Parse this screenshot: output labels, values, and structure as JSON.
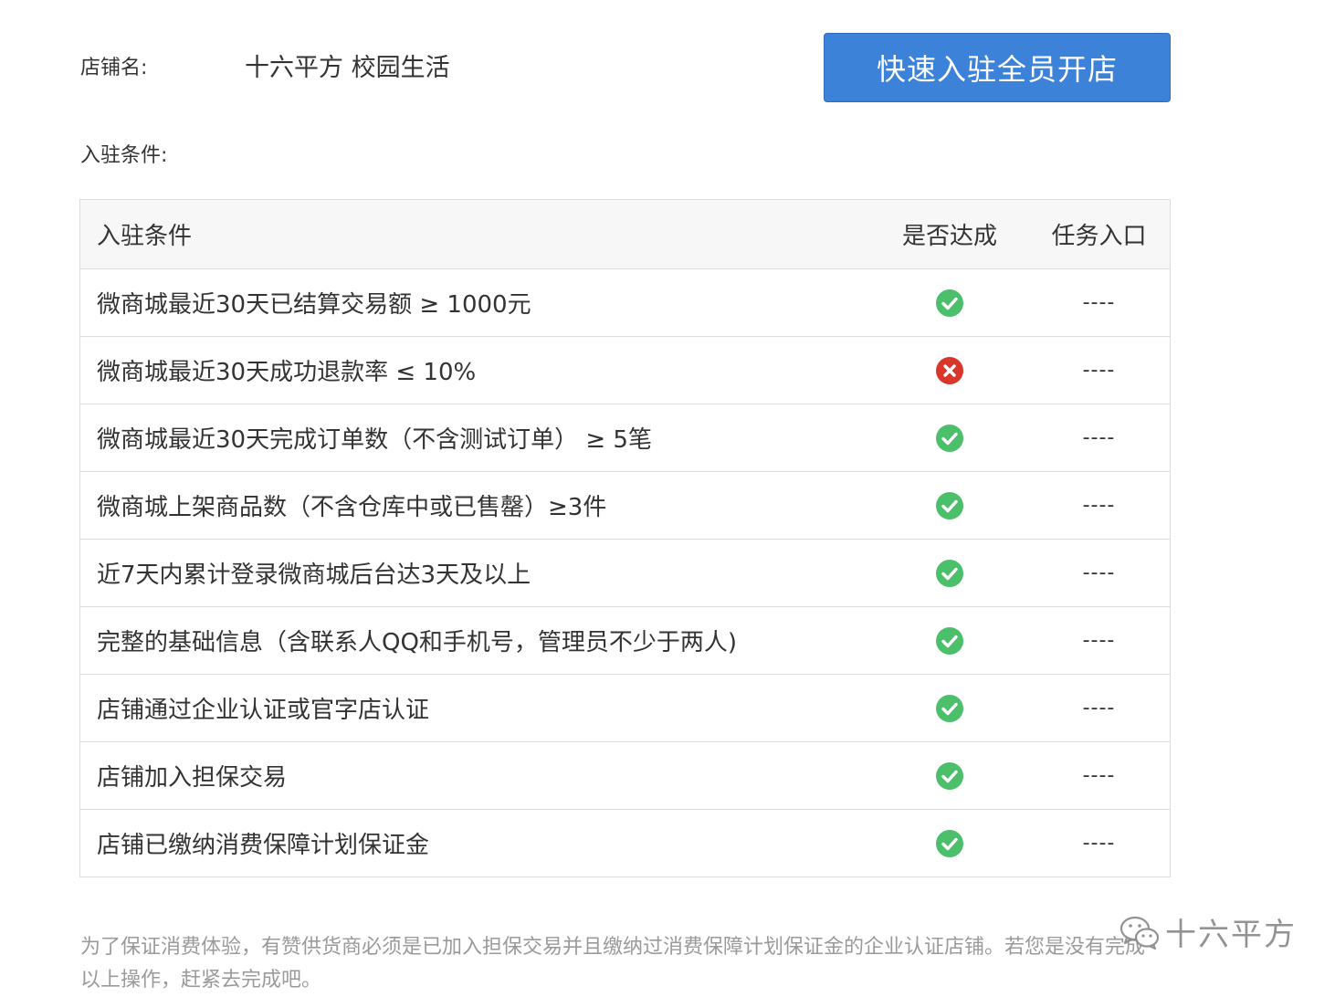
{
  "shop": {
    "label": "店铺名:",
    "name": "十六平方 校园生活"
  },
  "open_button_label": "快速入驻全员开店",
  "conditions_label": "入驻条件:",
  "table": {
    "headers": {
      "condition": "入驻条件",
      "achieved": "是否达成",
      "entry": "任务入口"
    },
    "rows": [
      {
        "condition": "微商城最近30天已结算交易额 ≥ 1000元",
        "achieved": true,
        "entry": "----"
      },
      {
        "condition": "微商城最近30天成功退款率 ≤ 10%",
        "achieved": false,
        "entry": "----"
      },
      {
        "condition": "微商城最近30天完成订单数（不含测试订单） ≥ 5笔",
        "achieved": true,
        "entry": "----"
      },
      {
        "condition": "微商城上架商品数（不含仓库中或已售罄）≥3件",
        "achieved": true,
        "entry": "----"
      },
      {
        "condition": "近7天内累计登录微商城后台达3天及以上",
        "achieved": true,
        "entry": "----"
      },
      {
        "condition": "完整的基础信息（含联系人QQ和手机号，管理员不少于两人)",
        "achieved": true,
        "entry": "----"
      },
      {
        "condition": "店铺通过企业认证或官字店认证",
        "achieved": true,
        "entry": "----"
      },
      {
        "condition": "店铺加入担保交易",
        "achieved": true,
        "entry": "----"
      },
      {
        "condition": "店铺已缴纳消费保障计划保证金",
        "achieved": true,
        "entry": "----"
      }
    ]
  },
  "footnote": "为了保证消费体验，有赞供货商必须是已加入担保交易并且缴纳过消费保障计划保证金的企业认证店铺。若您是没有完成以上操作，赶紧去完成吧。",
  "watermark": {
    "text": "十六平方",
    "icon": "wechat-icon"
  },
  "colors": {
    "button": "#3b82d8",
    "success": "#4cbf6b",
    "fail": "#d9372b",
    "footnote": "#9a9a9a"
  },
  "icons": {
    "achieved": "check-circle-icon",
    "not_achieved": "cross-circle-icon"
  }
}
